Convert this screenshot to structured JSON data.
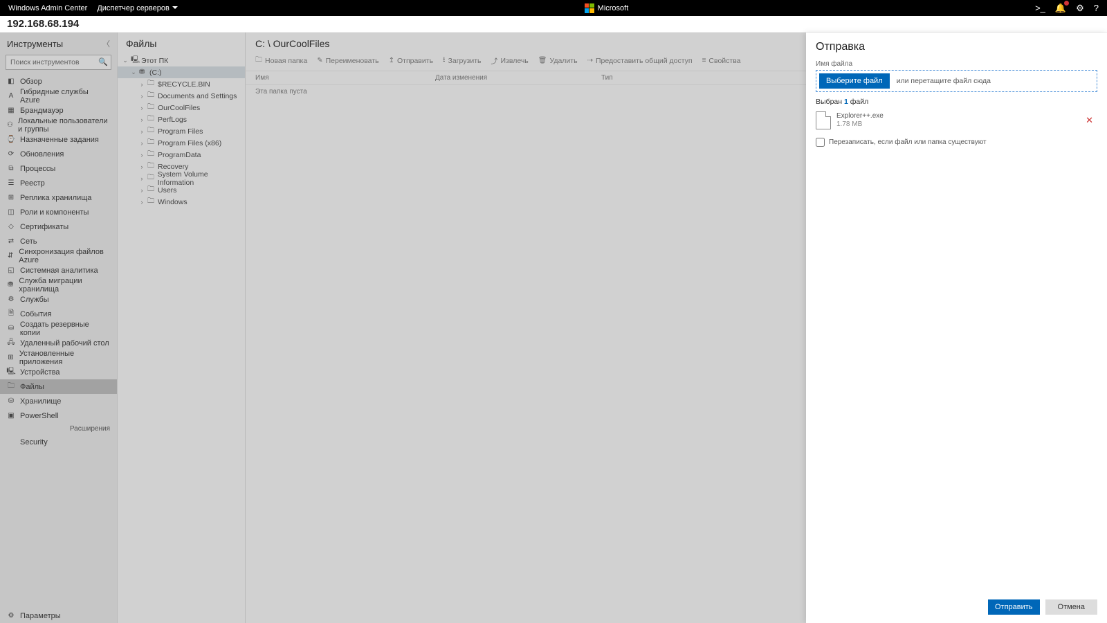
{
  "topbar": {
    "product": "Windows Admin Center",
    "context": "Диспетчер серверов",
    "brand": "Microsoft"
  },
  "host": "192.168.68.194",
  "tools": {
    "title": "Инструменты",
    "search_placeholder": "Поиск инструментов",
    "items": [
      {
        "icon": "◧",
        "label": "Обзор"
      },
      {
        "icon": "A",
        "label": "Гибридные службы Azure"
      },
      {
        "icon": "▦",
        "label": "Брандмауэр"
      },
      {
        "icon": "⚇",
        "label": "Локальные пользователи и группы"
      },
      {
        "icon": "⌚",
        "label": "Назначенные задания"
      },
      {
        "icon": "⟳",
        "label": "Обновления"
      },
      {
        "icon": "⧉",
        "label": "Процессы"
      },
      {
        "icon": "☰",
        "label": "Реестр"
      },
      {
        "icon": "⊞",
        "label": "Реплика хранилища"
      },
      {
        "icon": "◫",
        "label": "Роли и компоненты"
      },
      {
        "icon": "◇",
        "label": "Сертификаты"
      },
      {
        "icon": "⇄",
        "label": "Сеть"
      },
      {
        "icon": "⇵",
        "label": "Синхронизация файлов Azure"
      },
      {
        "icon": "◱",
        "label": "Системная аналитика"
      },
      {
        "icon": "⛃",
        "label": "Служба миграции хранилища"
      },
      {
        "icon": "⚙",
        "label": "Службы"
      },
      {
        "icon": "🗎",
        "label": "События"
      },
      {
        "icon": "⛁",
        "label": "Создать резервные копии"
      },
      {
        "icon": "🖧",
        "label": "Удаленный рабочий стол"
      },
      {
        "icon": "⊞",
        "label": "Установленные приложения"
      },
      {
        "icon": "🖳",
        "label": "Устройства"
      },
      {
        "icon": "🗀",
        "label": "Файлы",
        "active": true
      },
      {
        "icon": "⛁",
        "label": "Хранилище"
      },
      {
        "icon": "▣",
        "label": "PowerShell"
      }
    ],
    "extensions_label": "Расширения",
    "footer": [
      {
        "icon": "",
        "label": "Security"
      }
    ],
    "bottom": [
      {
        "icon": "⚙",
        "label": "Параметры"
      }
    ]
  },
  "tree": {
    "title": "Файлы",
    "root": {
      "label": "Этот ПК"
    },
    "drive": {
      "label": "(C:)",
      "selected": true
    },
    "folders": [
      "$RECYCLE.BIN",
      "Documents and Settings",
      "OurCoolFiles",
      "PerfLogs",
      "Program Files",
      "Program Files (x86)",
      "ProgramData",
      "Recovery",
      "System Volume Information",
      "Users",
      "Windows"
    ]
  },
  "content": {
    "breadcrumb": "C: \\ OurCoolFiles",
    "toolbar": [
      {
        "icon": "🗀",
        "label": "Новая папка"
      },
      {
        "icon": "✎",
        "label": "Переименовать"
      },
      {
        "icon": "↥",
        "label": "Отправить"
      },
      {
        "icon": "⭳",
        "label": "Загрузить"
      },
      {
        "icon": "⤴",
        "label": "Извлечь"
      },
      {
        "icon": "🗑",
        "label": "Удалить"
      },
      {
        "icon": "⇢",
        "label": "Предоставить общий доступ"
      },
      {
        "icon": "≡",
        "label": "Свойства"
      }
    ],
    "columns": {
      "c1": "Имя",
      "c2": "Дата изменения",
      "c3": "Тип"
    },
    "empty": "Эта папка пуста"
  },
  "panel": {
    "title": "Отправка",
    "field_label": "Имя файла",
    "choose_btn": "Выберите файл",
    "drag_text": "или перетащите файл сюда",
    "chosen_prefix": "Выбран ",
    "chosen_count": "1",
    "chosen_suffix": " файл",
    "file": {
      "name": "Explorer++.exe",
      "size": "1.78 MB"
    },
    "overwrite": "Перезаписать, если файл или папка существуют",
    "submit": "Отправить",
    "cancel": "Отмена"
  }
}
